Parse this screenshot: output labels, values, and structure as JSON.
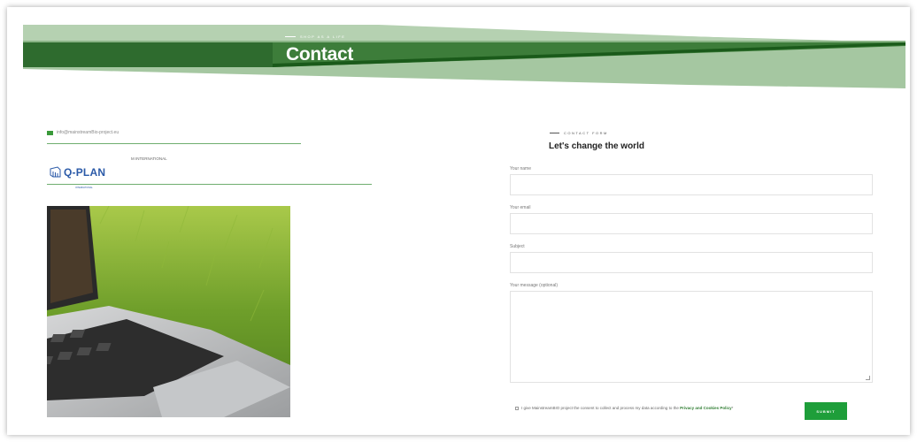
{
  "header": {
    "eyebrow": "Shop as a life",
    "title": "Contact"
  },
  "contact": {
    "email": "info@mainstreamBio-project.eu",
    "partner_label": "M INTERNATIONAL",
    "logo_text": "Q-PLAN",
    "logo_sub": "INTERNATIONAL"
  },
  "form": {
    "eyebrow": "Contact form",
    "title": "Let's change the world",
    "fields": [
      {
        "label": "Your name",
        "value": ""
      },
      {
        "label": "Your email",
        "value": ""
      },
      {
        "label": "Subject",
        "value": ""
      }
    ],
    "message_label": "Your message (optional)",
    "message_value": "",
    "consent_text": "I give MainstreamBIO project the consent to collect and process my data according to the ",
    "consent_link": "Privacy and Cookies Policy",
    "consent_suffix": "*",
    "submit_label": "Submit"
  },
  "colors": {
    "banner_dark": "#2e6b2e",
    "banner_light": "#a5c7a1",
    "accent": "#1e9e3a",
    "logo_blue": "#2b5aa8"
  },
  "icons": {
    "email": "envelope-icon",
    "logo": "qplan-logo-icon"
  }
}
